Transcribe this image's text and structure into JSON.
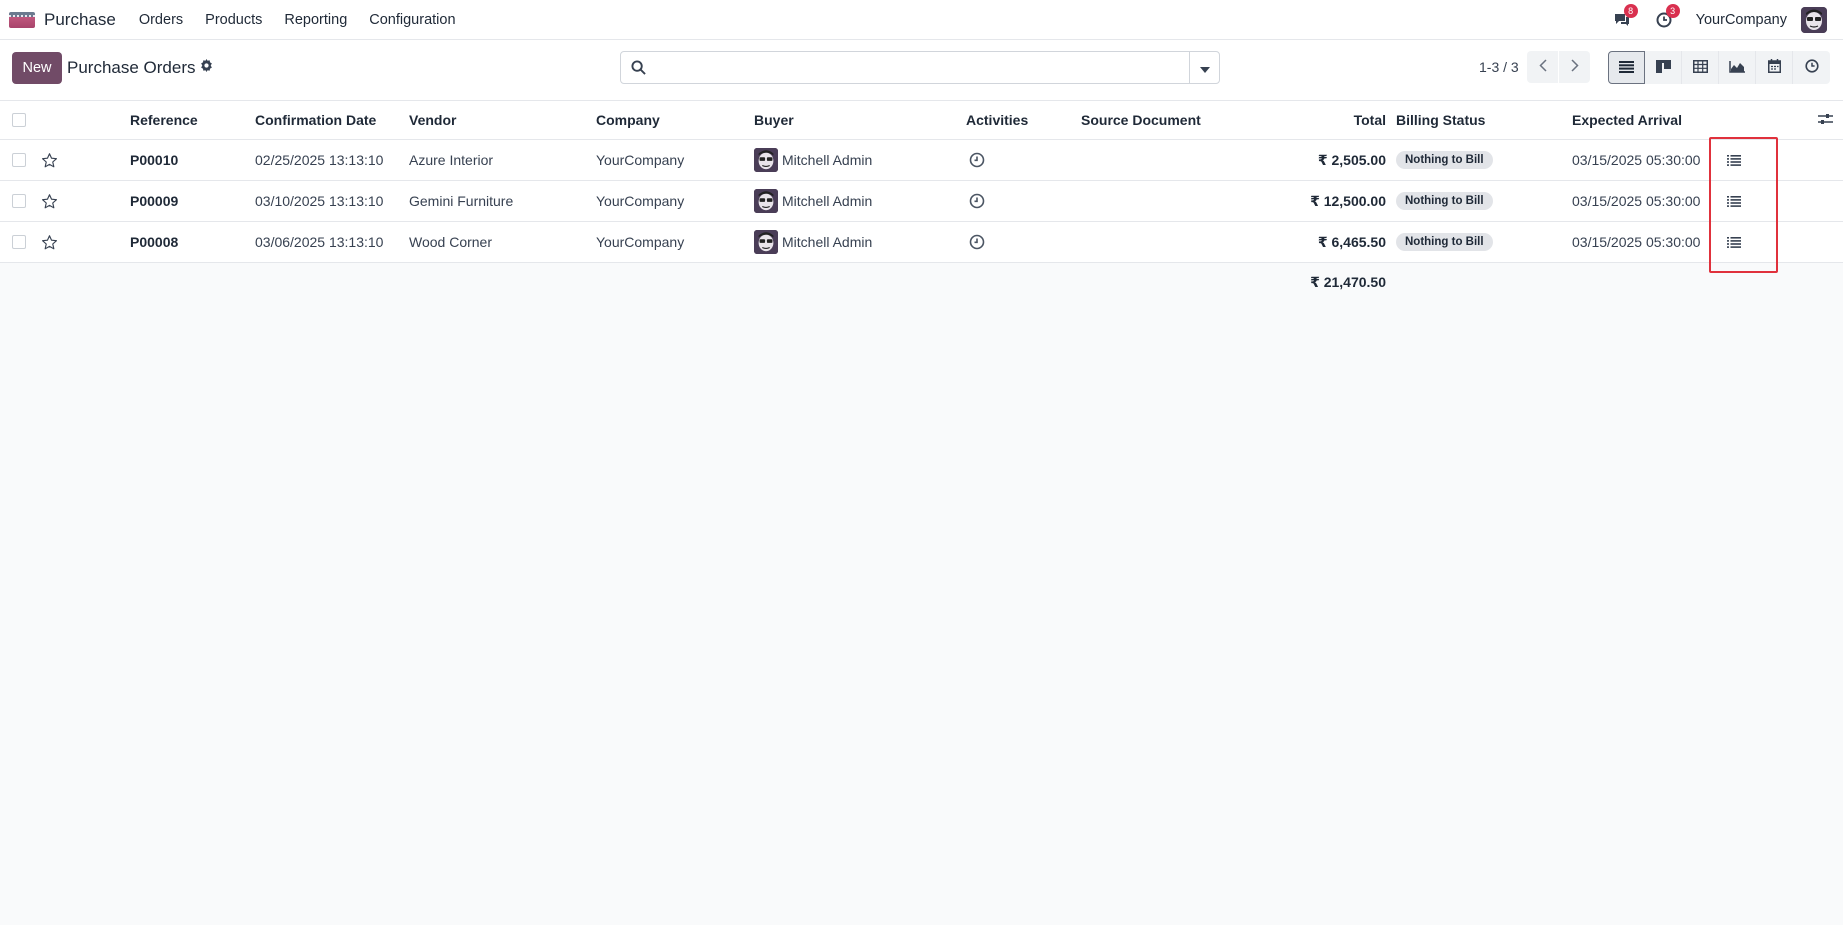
{
  "navbar": {
    "app_name": "Purchase",
    "menu": [
      "Orders",
      "Products",
      "Reporting",
      "Configuration"
    ],
    "messages_badge": "8",
    "activities_badge": "3",
    "company": "YourCompany"
  },
  "control_panel": {
    "new_label": "New",
    "title": "Purchase Orders",
    "search_placeholder": "",
    "pager": "1-3 / 3"
  },
  "views": [
    "list-view-icon",
    "kanban-view-icon",
    "pivot-view-icon",
    "graph-view-icon",
    "calendar-view-icon",
    "activity-view-icon"
  ],
  "table": {
    "headers": {
      "reference": "Reference",
      "confirmation_date": "Confirmation Date",
      "vendor": "Vendor",
      "company": "Company",
      "buyer": "Buyer",
      "activities": "Activities",
      "source_document": "Source Document",
      "total": "Total",
      "billing_status": "Billing Status",
      "expected_arrival": "Expected Arrival"
    },
    "rows": [
      {
        "reference": "P00010",
        "confirmation_date": "02/25/2025 13:13:10",
        "vendor": "Azure Interior",
        "company": "YourCompany",
        "buyer": "Mitchell Admin",
        "source_document": "",
        "total": "₹ 2,505.00",
        "billing_status": "Nothing to Bill",
        "expected_arrival": "03/15/2025 05:30:00"
      },
      {
        "reference": "P00009",
        "confirmation_date": "03/10/2025 13:13:10",
        "vendor": "Gemini Furniture",
        "company": "YourCompany",
        "buyer": "Mitchell Admin",
        "source_document": "",
        "total": "₹ 12,500.00",
        "billing_status": "Nothing to Bill",
        "expected_arrival": "03/15/2025 05:30:00"
      },
      {
        "reference": "P00008",
        "confirmation_date": "03/06/2025 13:13:10",
        "vendor": "Wood Corner",
        "company": "YourCompany",
        "buyer": "Mitchell Admin",
        "source_document": "",
        "total": "₹ 6,465.50",
        "billing_status": "Nothing to Bill",
        "expected_arrival": "03/15/2025 05:30:00"
      }
    ],
    "grand_total": "₹ 21,470.50"
  },
  "colors": {
    "brand": "#714b67",
    "badge": "#d9304f",
    "highlight": "#e0313c"
  }
}
